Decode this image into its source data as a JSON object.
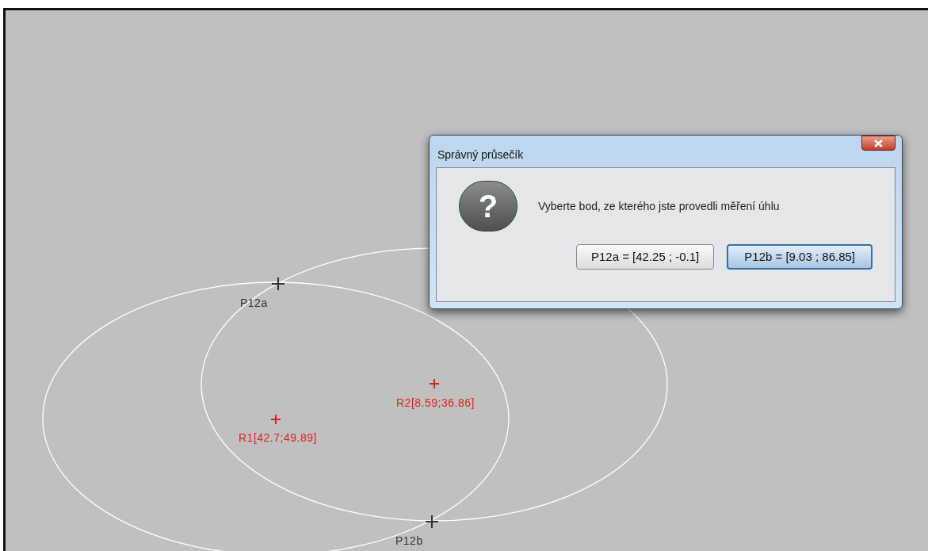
{
  "canvas": {
    "points": [
      {
        "kind": "intersection",
        "label": "P12a",
        "color": "#333333"
      },
      {
        "kind": "intersection",
        "label": "P12b",
        "color": "#333333"
      },
      {
        "kind": "center",
        "label": "R1[42.7;49.89]",
        "color": "#e02020"
      },
      {
        "kind": "center",
        "label": "R2[8.59;36.86]",
        "color": "#e02020"
      }
    ]
  },
  "dialog": {
    "title": "Správný průsečík",
    "icon": "?",
    "message": "Vyberte bod, ze kterého jste provedli měření úhlu",
    "buttons": [
      {
        "label": "P12a = [42.25 ; -0.1]",
        "selected": false
      },
      {
        "label": "P12b = [9.03 ; 86.85]",
        "selected": true
      }
    ]
  }
}
